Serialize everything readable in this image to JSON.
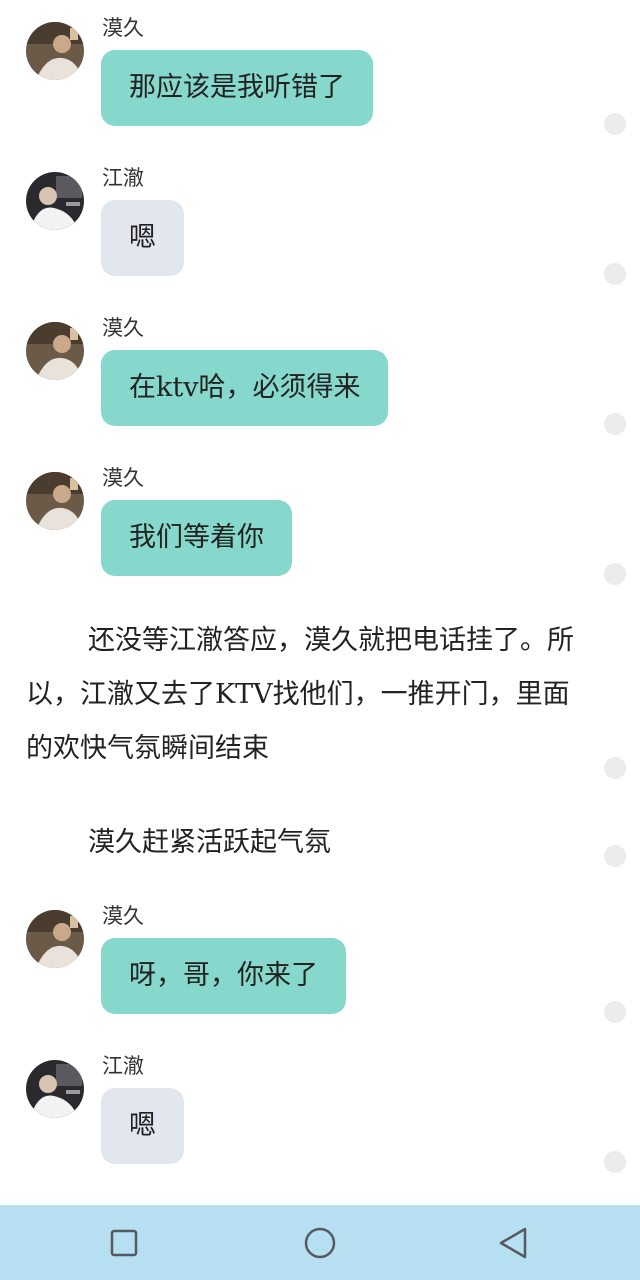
{
  "accent_teal": "#86d8cc",
  "accent_grey": "#e1e6ef",
  "navbar_color": "#b6dff2",
  "messages": [
    {
      "sender": "漠久",
      "text": "那应该是我听错了",
      "style": "teal",
      "avatar": "avatar-mojiu"
    },
    {
      "sender": "江澈",
      "text": "嗯",
      "style": "grey",
      "avatar": "avatar-jiangche"
    },
    {
      "sender": "漠久",
      "text": "在ktv哈，必须得来",
      "style": "teal",
      "avatar": "avatar-mojiu"
    },
    {
      "sender": "漠久",
      "text": "我们等着你",
      "style": "teal",
      "avatar": "avatar-mojiu"
    },
    {
      "sender": "漠久",
      "text": "呀，哥，你来了",
      "style": "teal",
      "avatar": "avatar-mojiu"
    },
    {
      "sender": "江澈",
      "text": "嗯",
      "style": "grey",
      "avatar": "avatar-jiangche"
    }
  ],
  "narration": [
    "还没等江澈答应，漠久就把电话挂了。所以，江澈又去了KTV找他们，一推开门，里面的欢快气氛瞬间结束",
    "漠久赶紧活跃起气氛"
  ],
  "navbar": {
    "icons": [
      "square-recents-icon",
      "circle-home-icon",
      "triangle-back-icon"
    ]
  }
}
